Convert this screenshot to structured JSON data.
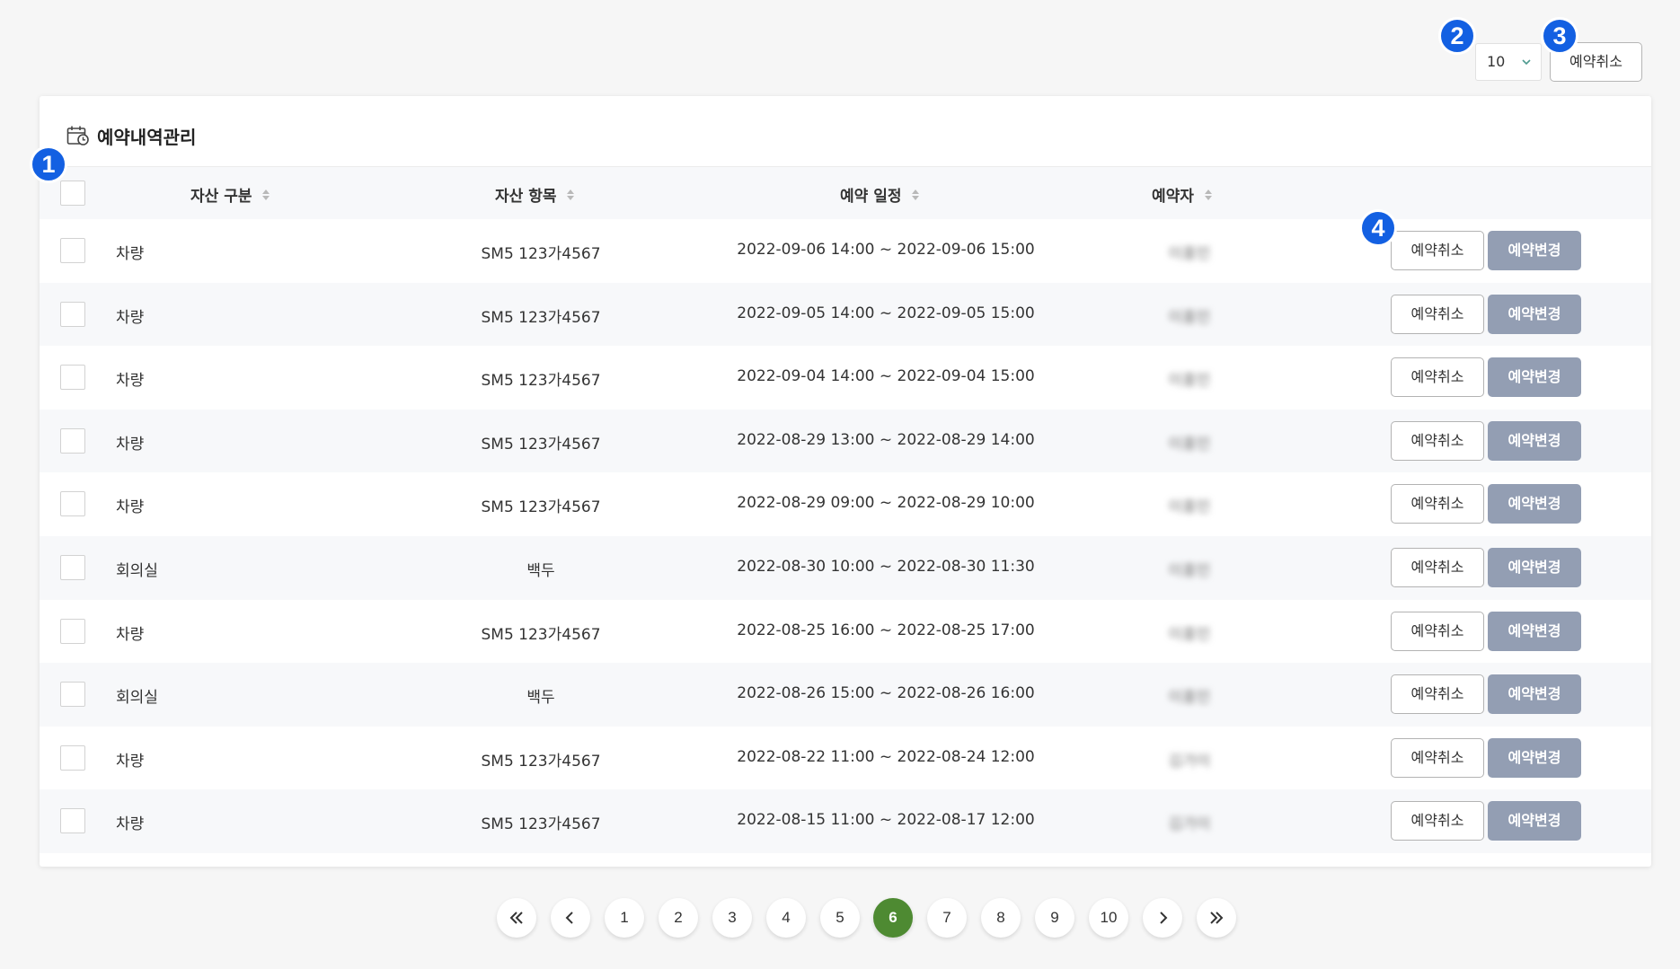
{
  "toolbar": {
    "per_page_value": "10",
    "cancel_label": "예약취소"
  },
  "card": {
    "title": "예약내역관리"
  },
  "table": {
    "columns": [
      "자산 구분",
      "자산 항목",
      "예약 일정",
      "예약자"
    ],
    "cancel_label": "예약취소",
    "change_label": "예약변경",
    "rows": [
      {
        "type": "차량",
        "item": "SM5 123가4567",
        "schedule": "2022-09-06 14:00 ~ 2022-09-06 15:00",
        "name": "이홍민"
      },
      {
        "type": "차량",
        "item": "SM5 123가4567",
        "schedule": "2022-09-05 14:00 ~ 2022-09-05 15:00",
        "name": "이홍민"
      },
      {
        "type": "차량",
        "item": "SM5 123가4567",
        "schedule": "2022-09-04 14:00 ~ 2022-09-04 15:00",
        "name": "이홍민"
      },
      {
        "type": "차량",
        "item": "SM5 123가4567",
        "schedule": "2022-08-29 13:00 ~ 2022-08-29 14:00",
        "name": "이홍민"
      },
      {
        "type": "차량",
        "item": "SM5 123가4567",
        "schedule": "2022-08-29 09:00 ~ 2022-08-29 10:00",
        "name": "이홍민"
      },
      {
        "type": "회의실",
        "item": "백두",
        "schedule": "2022-08-30 10:00 ~ 2022-08-30 11:30",
        "name": "이홍민"
      },
      {
        "type": "차량",
        "item": "SM5 123가4567",
        "schedule": "2022-08-25 16:00 ~ 2022-08-25 17:00",
        "name": "이홍민"
      },
      {
        "type": "회의실",
        "item": "백두",
        "schedule": "2022-08-26 15:00 ~ 2022-08-26 16:00",
        "name": "이홍민"
      },
      {
        "type": "차량",
        "item": "SM5 123가4567",
        "schedule": "2022-08-22 11:00 ~ 2022-08-24 12:00",
        "name": "김가이"
      },
      {
        "type": "차량",
        "item": "SM5 123가4567",
        "schedule": "2022-08-15 11:00 ~ 2022-08-17 12:00",
        "name": "김가이"
      }
    ]
  },
  "pagination": {
    "pages": [
      "1",
      "2",
      "3",
      "4",
      "5",
      "6",
      "7",
      "8",
      "9",
      "10"
    ],
    "current": "6"
  },
  "badges": [
    "1",
    "2",
    "3",
    "4"
  ],
  "colors": {
    "badge": "#1360e2",
    "active_page": "#4e8a32",
    "change_button": "#939eb3"
  }
}
